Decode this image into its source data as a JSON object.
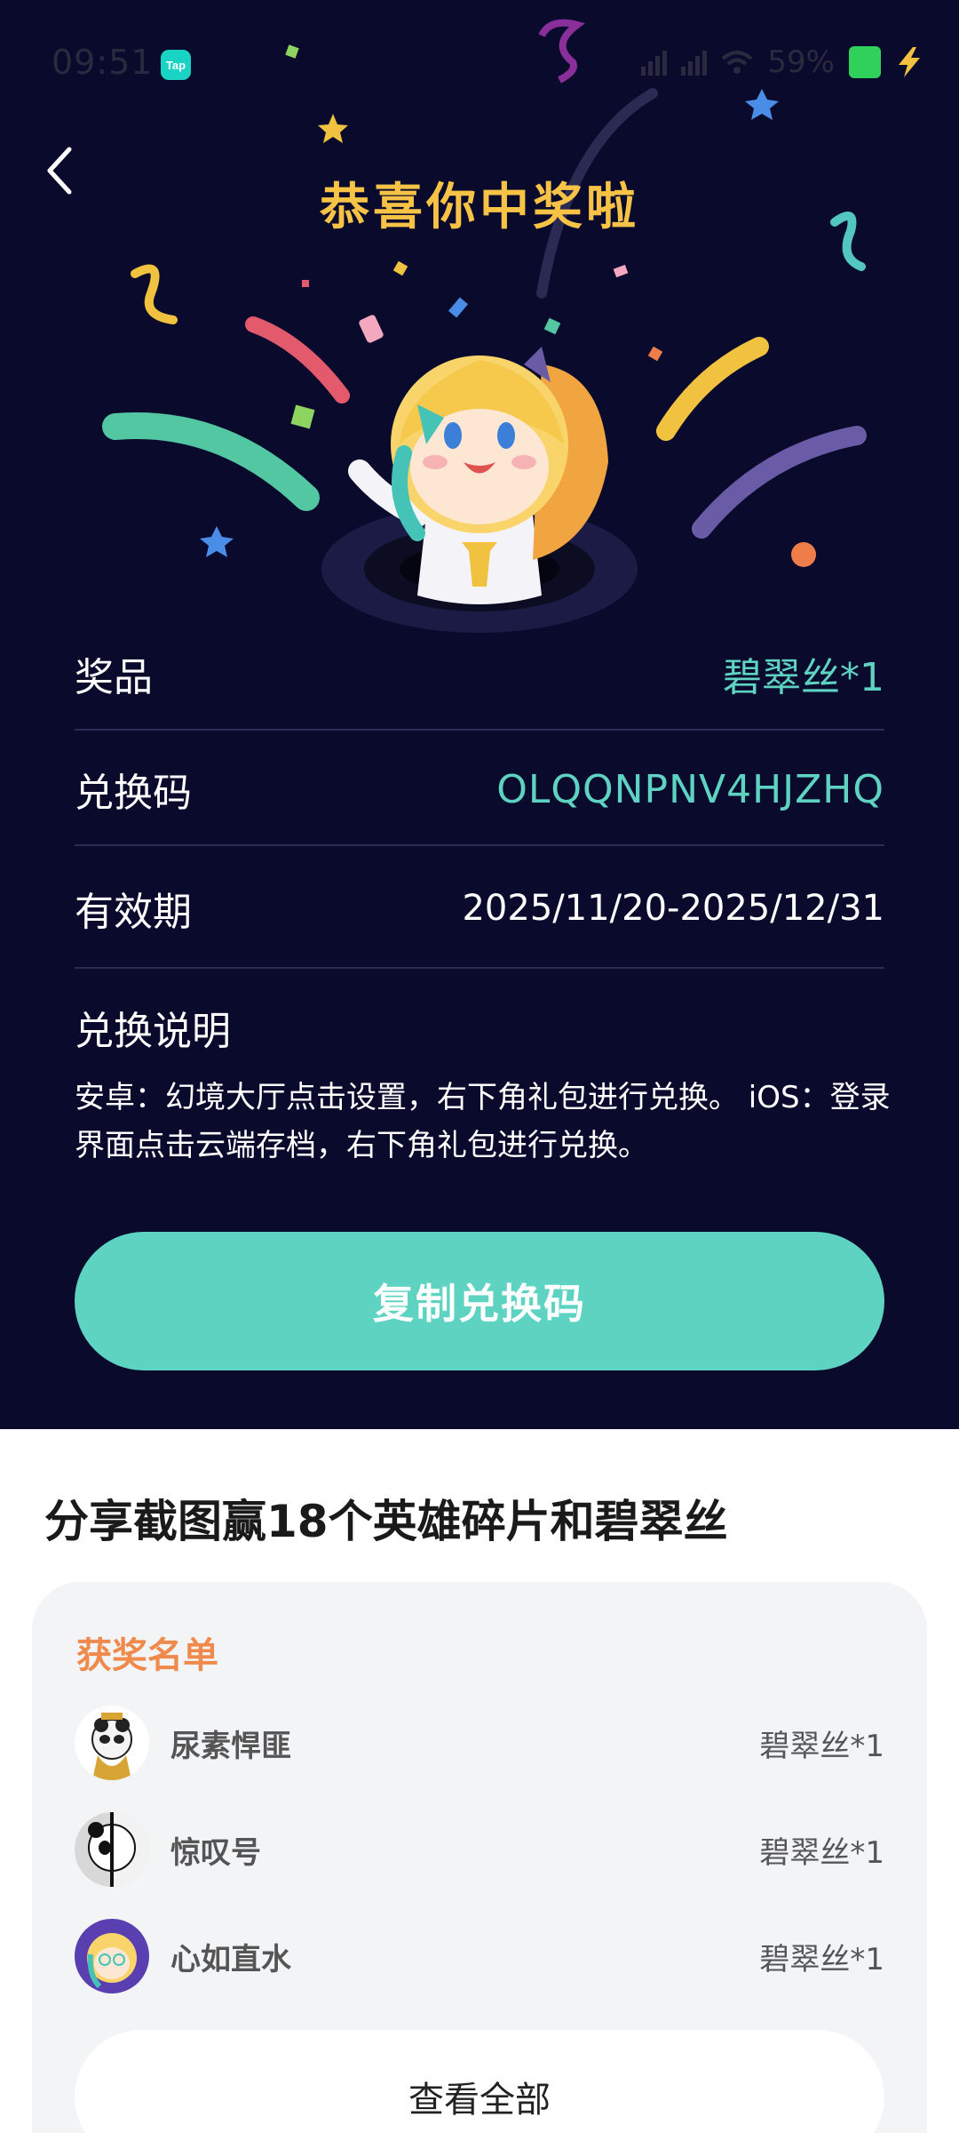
{
  "status_bar": {
    "time": "09:51",
    "app_badge": "Tap",
    "battery": "59%"
  },
  "hero": {
    "title": "恭喜你中奖啦"
  },
  "prize_info": {
    "prize_label": "奖品",
    "prize_value": "碧翠丝*1",
    "code_label": "兑换码",
    "code_value": "OLQQNPNV4HJZHQ",
    "validity_label": "有效期",
    "validity_value": "2025/11/20-2025/12/31",
    "desc_title": "兑换说明",
    "desc_text": "安卓：幻境大厅点击设置，右下角礼包进行兑换。 iOS：登录界面点击云端存档，右下角礼包进行兑换。"
  },
  "copy_button": "复制兑换码",
  "share": {
    "title": "分享截图赢18个英雄碎片和碧翠丝"
  },
  "winners": {
    "title": "获奖名单",
    "list": [
      {
        "name": "尿素悍匪",
        "prize": "碧翠丝*1"
      },
      {
        "name": "惊叹号",
        "prize": "碧翠丝*1"
      },
      {
        "name": "心如直水",
        "prize": "碧翠丝*1"
      }
    ],
    "view_all": "查看全部"
  },
  "colors": {
    "hero_bg": "#0a0a2d",
    "title_gold": "#f6c346",
    "accent_teal": "#5fd3c2",
    "winners_orange": "#ef8a4c"
  }
}
